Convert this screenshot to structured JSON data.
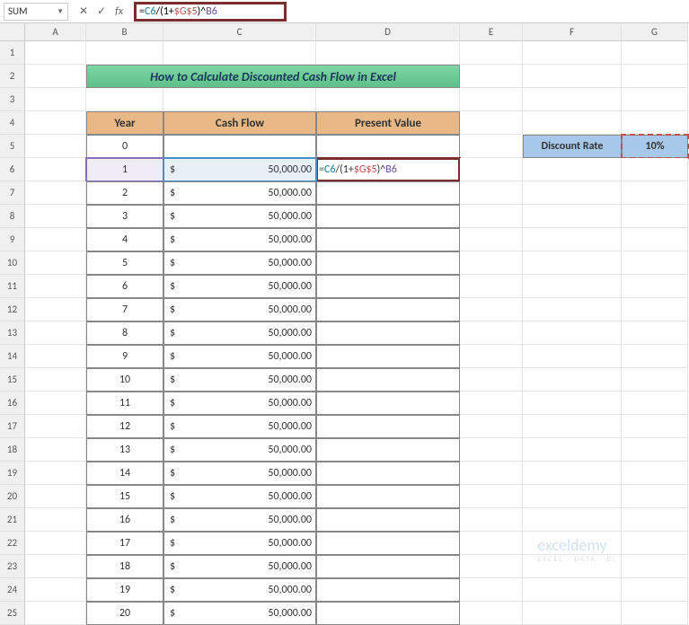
{
  "formula_bar": {
    "name_box": "SUM",
    "formula_display": "=C6/(1+$G$5)^B6",
    "formula_parts": {
      "eq": "=",
      "c6": "C6",
      "div": "/(1+",
      "g5": "$G$5",
      "close": ")^",
      "b6": "B6"
    }
  },
  "columns": [
    "A",
    "B",
    "C",
    "D",
    "E",
    "F",
    "G"
  ],
  "rows": [
    1,
    2,
    3,
    4,
    5,
    6,
    7,
    8,
    9,
    10,
    11,
    12,
    13,
    14,
    15,
    16,
    17,
    18,
    19,
    20,
    21,
    22,
    23,
    24,
    25
  ],
  "title": "How to Calculate Discounted Cash Flow in Excel",
  "headers": {
    "year": "Year",
    "cash_flow": "Cash Flow",
    "present_value": "Present Value"
  },
  "table": [
    {
      "year": "0",
      "cash": ""
    },
    {
      "year": "1",
      "cash": "50,000.00"
    },
    {
      "year": "2",
      "cash": "50,000.00"
    },
    {
      "year": "3",
      "cash": "50,000.00"
    },
    {
      "year": "4",
      "cash": "50,000.00"
    },
    {
      "year": "5",
      "cash": "50,000.00"
    },
    {
      "year": "6",
      "cash": "50,000.00"
    },
    {
      "year": "7",
      "cash": "50,000.00"
    },
    {
      "year": "8",
      "cash": "50,000.00"
    },
    {
      "year": "9",
      "cash": "50,000.00"
    },
    {
      "year": "10",
      "cash": "50,000.00"
    },
    {
      "year": "11",
      "cash": "50,000.00"
    },
    {
      "year": "12",
      "cash": "50,000.00"
    },
    {
      "year": "13",
      "cash": "50,000.00"
    },
    {
      "year": "14",
      "cash": "50,000.00"
    },
    {
      "year": "15",
      "cash": "50,000.00"
    },
    {
      "year": "16",
      "cash": "50,000.00"
    },
    {
      "year": "17",
      "cash": "50,000.00"
    },
    {
      "year": "18",
      "cash": "50,000.00"
    },
    {
      "year": "19",
      "cash": "50,000.00"
    },
    {
      "year": "20",
      "cash": "50,000.00"
    }
  ],
  "discount": {
    "label": "Discount Rate",
    "value": "10%"
  },
  "currency": "$",
  "watermark": {
    "brand": "exceldemy",
    "tag": "EXCEL · DATA · BI"
  }
}
